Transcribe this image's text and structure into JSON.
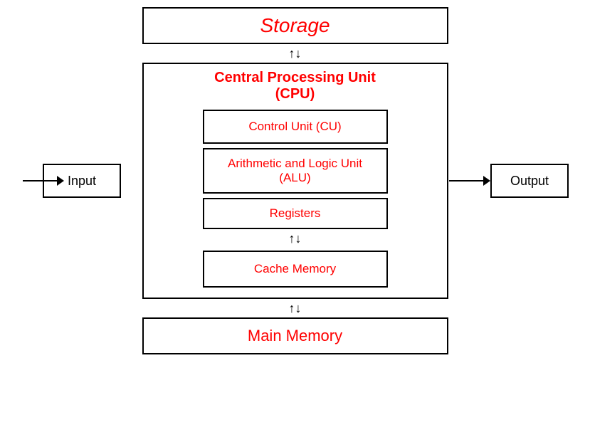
{
  "diagram": {
    "storage": {
      "label": "Storage"
    },
    "cpu": {
      "title_line1": "Central Processing Unit",
      "title_line2": "(CPU)",
      "control_unit": "Control Unit (CU)",
      "alu": "Arithmetic and Logic Unit (ALU)",
      "registers": "Registers",
      "cache_memory": "Cache Memory"
    },
    "main_memory": {
      "label": "Main Memory"
    },
    "input": {
      "label": "Input"
    },
    "output": {
      "label": "Output"
    },
    "arrow_updown": "↑↓",
    "arrow_right": "→"
  }
}
